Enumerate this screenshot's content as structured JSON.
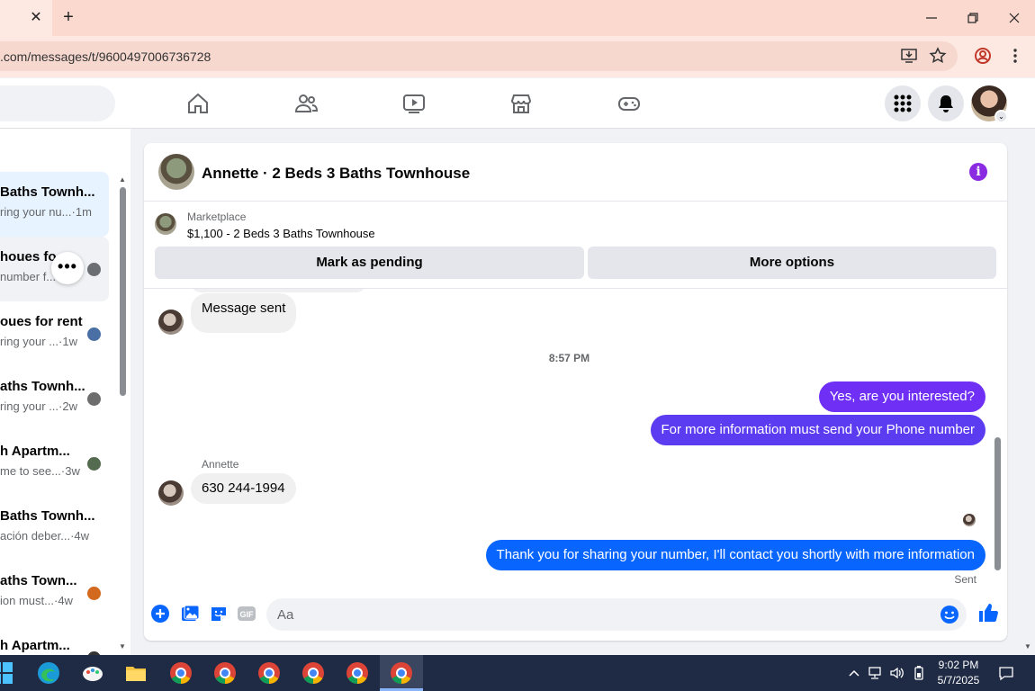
{
  "browser": {
    "url": ".com/messages/t/9600497006736728"
  },
  "chat_list": {
    "items": [
      {
        "name": "Baths Townh...",
        "preview": "ring your nu...",
        "time": "1m",
        "state": "active"
      },
      {
        "name": "houes fo",
        "preview": "number f...",
        "time": "",
        "state": "hover"
      },
      {
        "name": "oues for rent",
        "preview": "ring your ...",
        "time": "1w",
        "state": ""
      },
      {
        "name": "aths Townh...",
        "preview": "ring your ...",
        "time": "2w",
        "state": ""
      },
      {
        "name": "h Apartm...",
        "preview": "me to see...",
        "time": "3w",
        "state": ""
      },
      {
        "name": "Baths Townh...",
        "preview": "ación deber...",
        "time": "4w",
        "state": ""
      },
      {
        "name": "aths Town...",
        "preview": "ion must...",
        "time": "4w",
        "state": ""
      },
      {
        "name": "h Apartm...",
        "preview": "",
        "time": "",
        "state": ""
      }
    ],
    "more_options_glyph": "•••"
  },
  "conversation": {
    "title": "Annette · 2 Beds 3 Baths Townhouse",
    "marketplace_label": "Marketplace",
    "listing": "$1,100 - 2 Beds 3 Baths Townhouse",
    "mark_pending_label": "Mark as pending",
    "more_options_label": "More options",
    "messages": {
      "msg1": "Message sent",
      "timestamp": "8:57 PM",
      "msg2": "Yes, are you interested?",
      "msg3": "For more information must send your Phone number",
      "sender": "Annette",
      "msg4": "630 244-1994",
      "msg5": "Thank you for sharing your number, I'll contact you shortly with more information",
      "status": "Sent"
    },
    "composer_placeholder": "Aa"
  },
  "taskbar": {
    "time": "9:02 PM",
    "date": "5/7/2025"
  },
  "colors": {
    "outgoing_bubble_gradient_top": "#7b2ff7",
    "outgoing_bubble_gradient_bottom": "#0a7cff",
    "accent": "#0866ff",
    "info": "#8a2be2"
  },
  "icons": [
    "close-icon",
    "plus-icon",
    "minimize-icon",
    "restore-icon",
    "window-close-icon",
    "install-icon",
    "star-icon",
    "profile-icon",
    "menu-icon",
    "home-icon",
    "friends-icon",
    "video-icon",
    "marketplace-icon",
    "gaming-icon",
    "apps-grid-icon",
    "bell-icon",
    "info-icon",
    "add-icon",
    "photo-icon",
    "sticker-icon",
    "gif-icon",
    "emoji-icon",
    "like-icon"
  ]
}
